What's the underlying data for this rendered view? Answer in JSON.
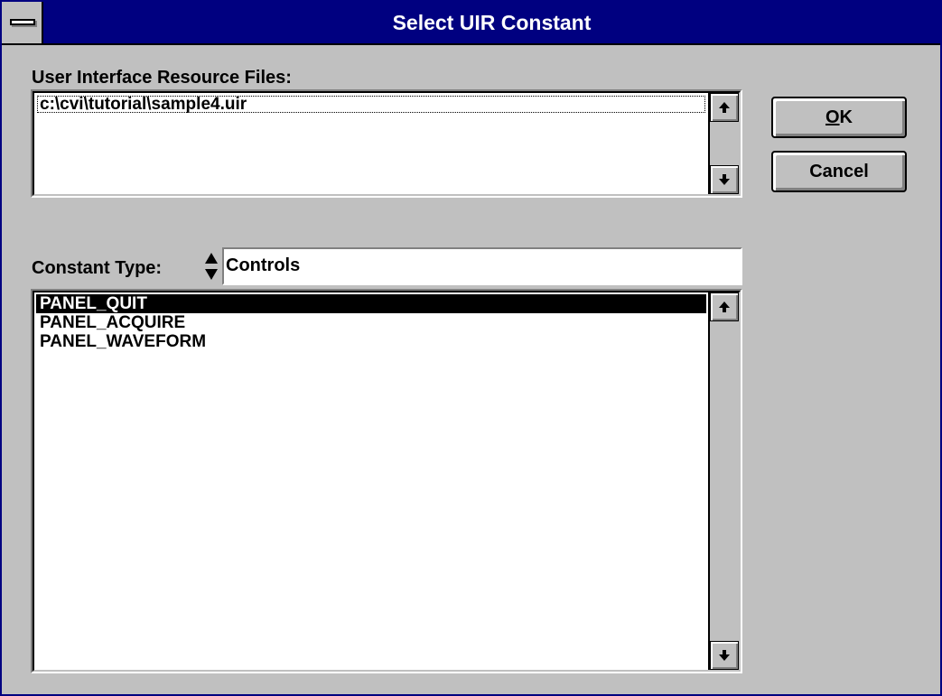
{
  "window": {
    "title": "Select UIR Constant"
  },
  "uir_files": {
    "label": "User Interface Resource Files:",
    "items": [
      "c:\\cvi\\tutorial\\sample4.uir"
    ]
  },
  "buttons": {
    "ok_mnemonic": "O",
    "ok_rest": "K",
    "cancel": "Cancel"
  },
  "constant_type": {
    "label": "Constant Type:",
    "value": "Controls"
  },
  "constants": {
    "items": [
      "PANEL_QUIT",
      "PANEL_ACQUIRE",
      "PANEL_WAVEFORM"
    ],
    "selected_index": 0
  },
  "icons": {
    "scroll_up": "up-arrow-icon",
    "scroll_down": "down-arrow-icon",
    "spinner": "up-down-spinner-icon",
    "system_menu": "system-menu-icon"
  },
  "colors": {
    "title_bar": "#000080",
    "dialog_face": "#c0c0c0",
    "selection": "#000000"
  }
}
